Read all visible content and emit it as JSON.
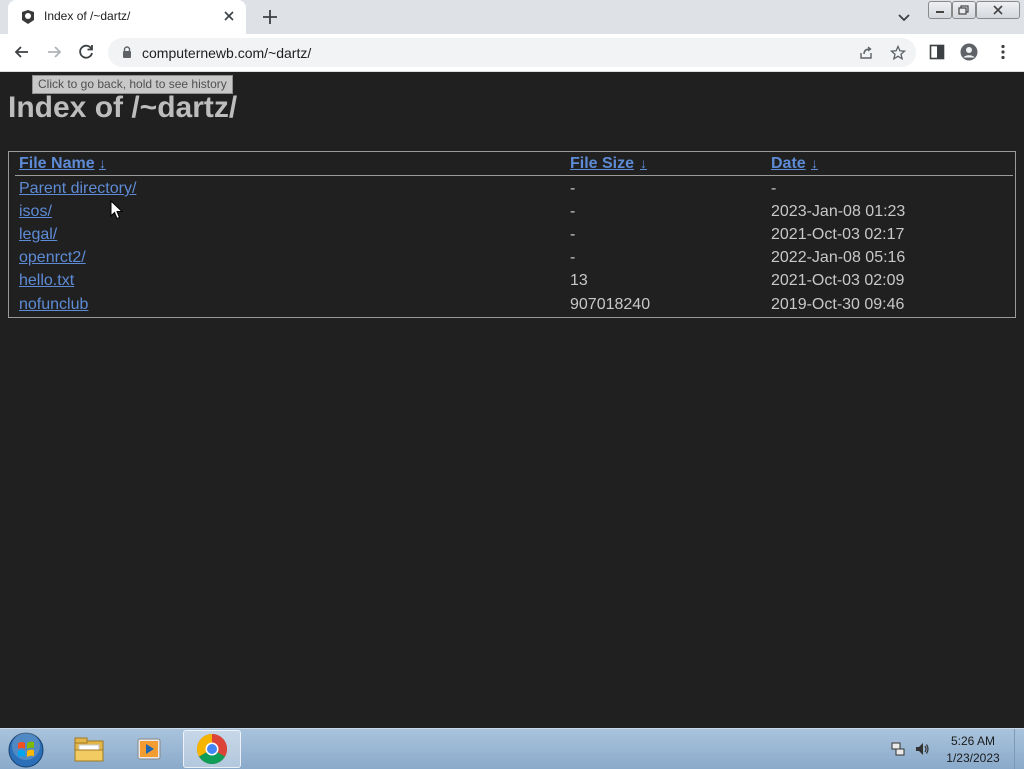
{
  "browser": {
    "tab": {
      "title": "Index of /~dartz/"
    },
    "address_bar": {
      "url": "computernewb.com/~dartz/"
    },
    "tooltip": "Click to go back, hold to see history"
  },
  "page": {
    "title": "Index of /~dartz/",
    "columns": {
      "name": "File Name",
      "size": "File Size",
      "date": "Date",
      "sort_arrow": "↓"
    },
    "rows": [
      {
        "name": "Parent directory/",
        "size": "-",
        "date": "-"
      },
      {
        "name": "isos/",
        "size": "-",
        "date": "2023-Jan-08 01:23"
      },
      {
        "name": "legal/",
        "size": "-",
        "date": "2021-Oct-03 02:17"
      },
      {
        "name": "openrct2/",
        "size": "-",
        "date": "2022-Jan-08 05:16"
      },
      {
        "name": "hello.txt",
        "size": "13",
        "date": "2021-Oct-03 02:09"
      },
      {
        "name": "nofunclub",
        "size": "907018240",
        "date": "2019-Oct-30 09:46"
      }
    ]
  },
  "taskbar": {
    "apps": [
      "windows-explorer-icon",
      "media-player-icon",
      "chrome-icon"
    ],
    "clock": {
      "time": "5:26 AM",
      "date": "1/23/2023"
    }
  },
  "colors": {
    "link": "#5e8bd5",
    "page_bg": "#202020",
    "text": "#c8c8c8"
  }
}
